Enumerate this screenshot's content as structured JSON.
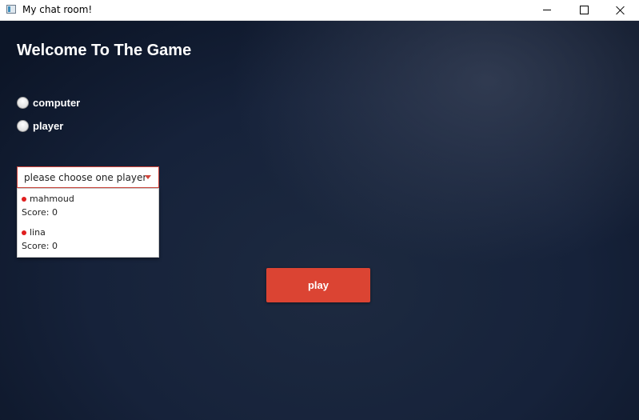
{
  "window": {
    "title": "My chat room!",
    "icon": "app-window-icon",
    "controls": [
      "minimize-icon",
      "maximize-icon",
      "close-icon"
    ]
  },
  "main": {
    "heading": "Welcome To The Game",
    "mode_options": [
      {
        "label": "computer",
        "selected": false
      },
      {
        "label": "player",
        "selected": false
      }
    ],
    "player_select": {
      "selected_text": "please choose one player",
      "open": true,
      "options": [
        {
          "name": "mahmoud",
          "score": "Score: 0",
          "status_color": "#e01e1e"
        },
        {
          "name": "lina",
          "score": "Score: 0",
          "status_color": "#e01e1e"
        }
      ]
    },
    "play_button": {
      "label": "play"
    }
  },
  "colors": {
    "accent": "#db4433",
    "background": "#16223a",
    "text": "#ffffff"
  }
}
